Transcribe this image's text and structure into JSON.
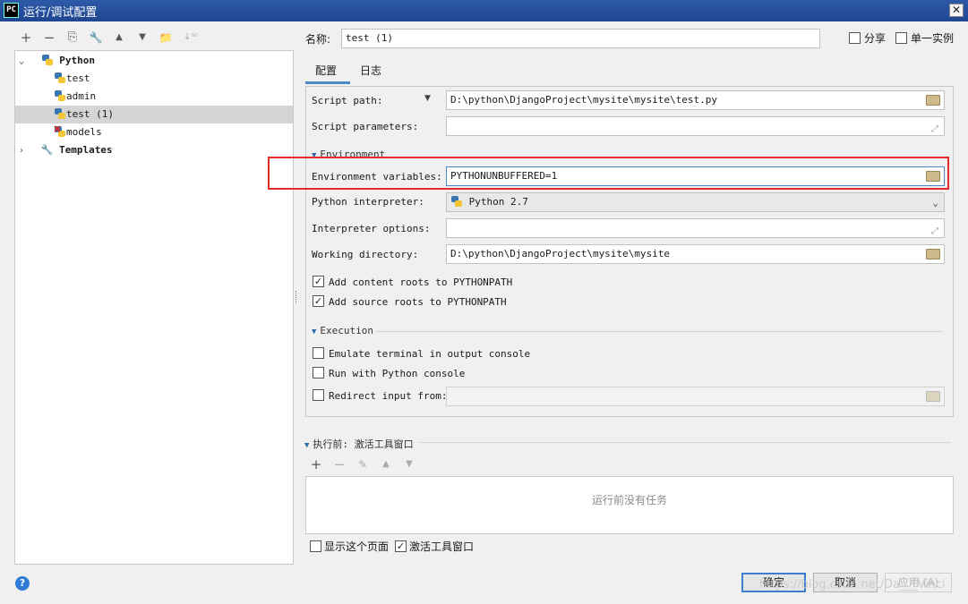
{
  "window": {
    "app_icon": "PC",
    "title": "运行/调试配置",
    "close": "✕"
  },
  "toolbar": {
    "add": "+",
    "remove": "−",
    "copy": "⎘",
    "edit": "🔧",
    "up": "▲",
    "down": "▼",
    "folder": "📁",
    "sort": "↓ᵃᶻ"
  },
  "tree": {
    "python": "Python",
    "items": [
      "test",
      "admin",
      "test (1)",
      "models"
    ],
    "templates": "Templates"
  },
  "header": {
    "name_label": "名称:",
    "name_value": "test (1)",
    "share_label": "分享",
    "single_label": "单一实例"
  },
  "tabs": [
    "配置",
    "日志"
  ],
  "config": {
    "script_path_label": "Script path:",
    "script_path_value": "D:\\python\\DjangoProject\\mysite\\mysite\\test.py",
    "script_params_label": "Script parameters:",
    "environment_section": "Environment",
    "env_vars_label": "Environment variables:",
    "env_vars_value": "PYTHONUNBUFFERED=1",
    "interpreter_label": "Python interpreter:",
    "interpreter_value": "Python 2.7",
    "interp_options_label": "Interpreter options:",
    "working_dir_label": "Working directory:",
    "working_dir_value": "D:\\python\\DjangoProject\\mysite\\mysite",
    "content_roots_label": "Add content roots to PYTHONPATH",
    "source_roots_label": "Add source roots to PYTHONPATH",
    "execution_section": "Execution",
    "emulate_label": "Emulate terminal in output console",
    "run_console_label": "Run with Python console",
    "redirect_label": "Redirect input from:"
  },
  "before_launch": {
    "title": "执行前: 激活工具窗口",
    "empty_text": "运行前没有任务",
    "show_page_label": "显示这个页面",
    "activate_label": "激活工具窗口"
  },
  "buttons": {
    "ok": "确定",
    "cancel": "取消",
    "apply": "应用 (A)"
  },
  "help": "?",
  "watermark": "https://blog.csdn.net/Da___Vinci",
  "colors": {
    "title_bar": "#1f4690",
    "highlight": "#e32b2b",
    "accent": "#3c7fcc"
  }
}
